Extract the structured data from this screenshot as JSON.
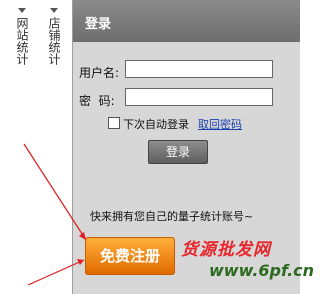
{
  "tabs": {
    "site_stats": "网站统计",
    "shop_stats": "店铺统计"
  },
  "login": {
    "title": "登录",
    "username_label": "用户名:",
    "password_label": "密  码:",
    "username_value": "",
    "password_value": "",
    "auto_login_label": "下次自动登录",
    "auto_login_checked": false,
    "forgot_link": "取回密码",
    "submit_label": "登录"
  },
  "promo": {
    "text": "快来拥有您自己的量子统计账号~",
    "register_label": "免费注册"
  },
  "watermark": {
    "line1": "货源批发网",
    "line2": "www.6pf.cn"
  },
  "colors": {
    "panel_bg": "#d7d7d7",
    "header_bg": "#7a7a7a",
    "register_orange": "#f08a1a",
    "link_blue": "#1a3fb0",
    "arrow_red": "#e11d1d"
  }
}
